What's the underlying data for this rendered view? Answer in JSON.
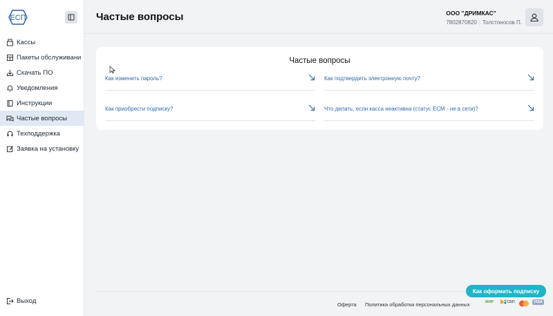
{
  "logo": {
    "text": "ЕСП"
  },
  "sidebar": {
    "items": [
      {
        "label": "Кассы",
        "icon": "cash-register-icon",
        "active": false
      },
      {
        "label": "Пакеты обслуживани",
        "icon": "package-icon",
        "active": false
      },
      {
        "label": "Скачать ПО",
        "icon": "download-icon",
        "active": false
      },
      {
        "label": "Уведомления",
        "icon": "bell-icon",
        "active": false
      },
      {
        "label": "Инструкции",
        "icon": "book-icon",
        "active": false
      },
      {
        "label": "Частые вопросы",
        "icon": "chat-icon",
        "active": true
      },
      {
        "label": "Техподдержка",
        "icon": "headset-icon",
        "active": false
      },
      {
        "label": "Заявка на установку",
        "icon": "edit-icon",
        "active": false
      }
    ],
    "logout_label": "Выход"
  },
  "header": {
    "title": "Частые вопросы",
    "org_name": "ООО \"ДРИМКАС\"",
    "inn": "7802870820",
    "user": "Толстоносов П."
  },
  "faq": {
    "title": "Частые вопросы",
    "items": [
      {
        "question": "Как изменить пароль?"
      },
      {
        "question": "Как подтвердить электронную почту?"
      },
      {
        "question": "Как приобрести подписку?"
      },
      {
        "question": "Что делать, если касса неактивна (статус ЕСМ - не в сети)?"
      }
    ]
  },
  "footer": {
    "offer_label": "Оферта",
    "privacy_label": "Политика обработки персональных данных",
    "subscribe_label": "Как оформить подписку",
    "payment_systems": [
      "МИР",
      "СБП",
      "Mastercard",
      "VISA"
    ]
  },
  "colors": {
    "accent": "#20b4c9",
    "link": "#2f6aa8",
    "active_bg": "#dfe8f3",
    "logo": "#2b5fa3"
  }
}
